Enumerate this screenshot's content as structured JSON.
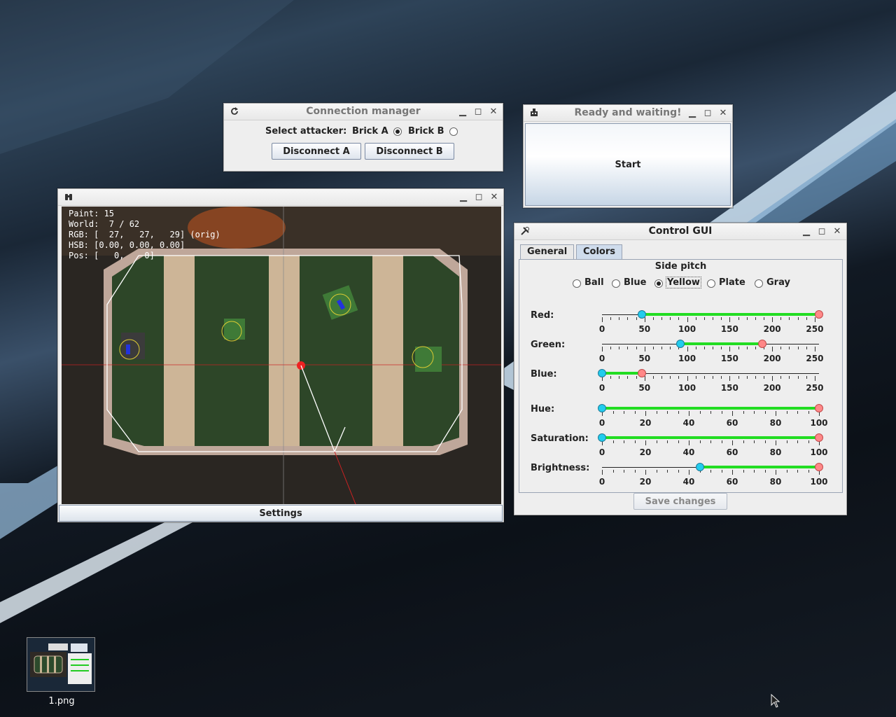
{
  "desktop": {
    "thumbnail_label": "1.png"
  },
  "connection_manager": {
    "title": "Connection manager",
    "select_label": "Select attacker:",
    "brick_a_label": "Brick A",
    "brick_b_label": "Brick B",
    "selected": "Brick A",
    "disconnect_a": "Disconnect A",
    "disconnect_b": "Disconnect B"
  },
  "ready_window": {
    "title": "Ready and waiting!",
    "start_label": "Start"
  },
  "vision_window": {
    "overlay": {
      "paint": "Paint: 15",
      "world": "World:  7 / 62",
      "rgb": "RGB: [  27,   27,   29] (orig)",
      "hsb": "HSB: [0.00, 0.00, 0.00]",
      "pos": "Pos: [   0,    0]"
    },
    "settings_label": "Settings"
  },
  "control_gui": {
    "title": "Control GUI",
    "tabs": [
      {
        "label": "General",
        "selected": false
      },
      {
        "label": "Colors",
        "selected": true
      }
    ],
    "section_title": "Side pitch",
    "object_options": [
      {
        "label": "Ball",
        "selected": false
      },
      {
        "label": "Blue",
        "selected": false
      },
      {
        "label": "Yellow",
        "selected": true
      },
      {
        "label": "Plate",
        "selected": false
      },
      {
        "label": "Gray",
        "selected": false
      }
    ],
    "sliders": [
      {
        "name": "Red:",
        "min": 0,
        "max": 255,
        "low": 47,
        "high": 255,
        "ticks": [
          "0",
          "50",
          "100",
          "150",
          "200",
          "250"
        ]
      },
      {
        "name": "Green:",
        "min": 0,
        "max": 255,
        "low": 92,
        "high": 188,
        "ticks": [
          "0",
          "50",
          "100",
          "150",
          "200",
          "250"
        ]
      },
      {
        "name": "Blue:",
        "min": 0,
        "max": 255,
        "low": 0,
        "high": 47,
        "ticks": [
          "0",
          "50",
          "100",
          "150",
          "200",
          "250"
        ]
      },
      {
        "name": "Hue:",
        "min": 0,
        "max": 100,
        "low": 0,
        "high": 100,
        "ticks": [
          "0",
          "20",
          "40",
          "60",
          "80",
          "100"
        ]
      },
      {
        "name": "Saturation:",
        "min": 0,
        "max": 100,
        "low": 0,
        "high": 100,
        "ticks": [
          "0",
          "20",
          "40",
          "60",
          "80",
          "100"
        ]
      },
      {
        "name": "Brightness:",
        "min": 0,
        "max": 100,
        "low": 45,
        "high": 100,
        "ticks": [
          "0",
          "20",
          "40",
          "60",
          "80",
          "100"
        ]
      }
    ],
    "save_label": "Save changes"
  },
  "colors": {
    "slider_range": "#22dd22",
    "knob_low": "#22ccee",
    "knob_high": "#ff8888",
    "tab_selected": "#cfdcec"
  }
}
